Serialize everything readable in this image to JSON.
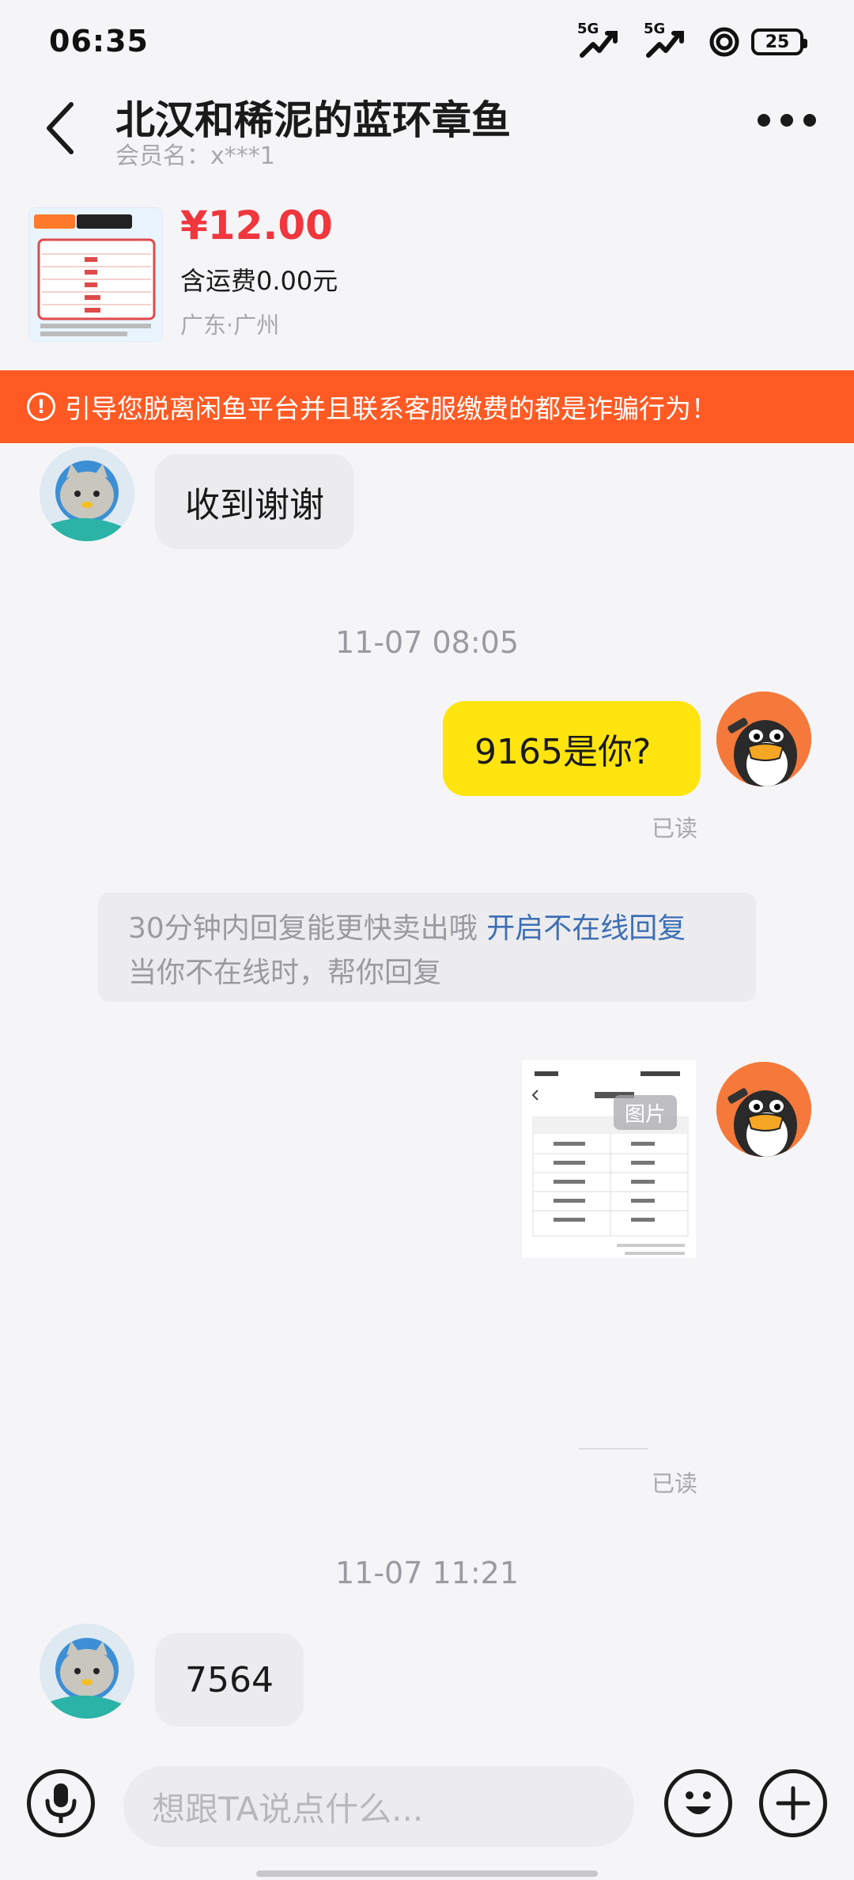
{
  "status_bar": {
    "time": "06:35",
    "signal1_label": "5G",
    "signal2_label": "5G",
    "battery": "25"
  },
  "header": {
    "title": "北汉和稀泥的蓝环章鱼",
    "subtitle": "会员名：x***1"
  },
  "product": {
    "price": "¥12.00",
    "shipping": "含运费0.00元",
    "location": "广东·广州"
  },
  "warning": {
    "icon": "!",
    "text": "引导您脱离闲鱼平台并且联系客服缴费的都是诈骗行为！"
  },
  "messages": {
    "msg1": "收到谢谢",
    "time1": "11-07 08:05",
    "msg2": "9165是你?",
    "read1": "已读",
    "notice_line1": "30分钟内回复能更快卖出哦 ",
    "notice_link": "开启不在线回复",
    "notice_line2": "当你不在线时，帮你回复",
    "image_tag": "图片",
    "read2": "已读",
    "time2": "11-07 11:21",
    "msg3": "7564"
  },
  "input_bar": {
    "placeholder": "想跟TA说点什么..."
  },
  "colors": {
    "accent_orange": "#ff5a24",
    "price_red": "#f0373d",
    "bubble_yellow": "#ffe40f",
    "link_blue": "#3d6fb6"
  }
}
